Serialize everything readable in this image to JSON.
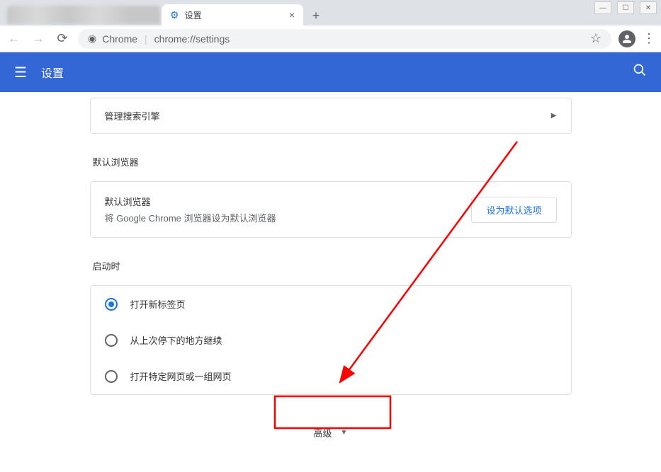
{
  "window": {
    "minimize": "▭",
    "maximize": "☐",
    "close": "✕"
  },
  "tabs": {
    "active": {
      "title": "设置"
    },
    "new_tab_plus": "+"
  },
  "toolbar": {
    "site_label": "Chrome",
    "url": "chrome://settings"
  },
  "header": {
    "title": "设置"
  },
  "search_engines": {
    "manage_label": "管理搜索引擎"
  },
  "default_browser": {
    "section_title": "默认浏览器",
    "title": "默认浏览器",
    "subtitle": "将 Google Chrome 浏览器设为默认浏览器",
    "button": "设为默认选项"
  },
  "startup": {
    "section_title": "启动时",
    "options": [
      {
        "label": "打开新标签页",
        "selected": true
      },
      {
        "label": "从上次停下的地方继续",
        "selected": false
      },
      {
        "label": "打开特定网页或一组网页",
        "selected": false
      }
    ]
  },
  "advanced": {
    "label": "高级"
  }
}
